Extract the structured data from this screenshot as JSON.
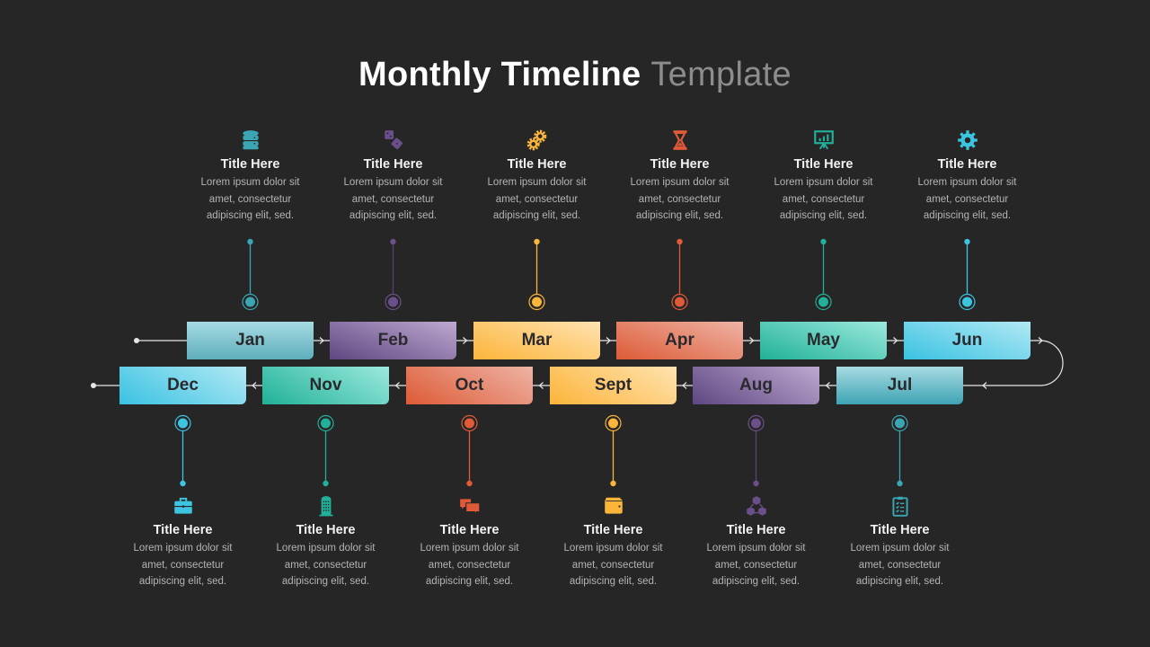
{
  "header": {
    "title_bold": "Monthly Timeline",
    "title_light": "Template"
  },
  "months": [
    {
      "label": "Jan",
      "color": "#3aa6b4",
      "grad": [
        "#5eaebb",
        "#a6dbe3"
      ],
      "icon": "database-icon"
    },
    {
      "label": "Feb",
      "color": "#6b4f8a",
      "grad": [
        "#5e4781",
        "#bda9d1"
      ],
      "icon": "dice-icon"
    },
    {
      "label": "Mar",
      "color": "#fbb53a",
      "grad": [
        "#fcb43a",
        "#ffe3b0"
      ],
      "icon": "gears-icon"
    },
    {
      "label": "Apr",
      "color": "#e15a38",
      "grad": [
        "#dd5b36",
        "#eeb3a5"
      ],
      "icon": "hourglass-icon"
    },
    {
      "label": "May",
      "color": "#22b09a",
      "grad": [
        "#20b197",
        "#9ce9de"
      ],
      "icon": "presentation-chart-icon"
    },
    {
      "label": "Jun",
      "color": "#3cc4e0",
      "grad": [
        "#3ac2e2",
        "#b2e9f4"
      ],
      "icon": "settings-gear-icon"
    },
    {
      "label": "Jul",
      "color": "#3aa6b4",
      "grad": [
        "#3ea4b4",
        "#a8dbe2"
      ],
      "icon": "clipboard-checklist-icon"
    },
    {
      "label": "Aug",
      "color": "#6b4f8a",
      "grad": [
        "#5e4781",
        "#bda9d1"
      ],
      "icon": "network-cubes-icon"
    },
    {
      "label": "Sept",
      "color": "#fbb53a",
      "grad": [
        "#fcb43a",
        "#ffe3b0"
      ],
      "icon": "wallet-icon"
    },
    {
      "label": "Oct",
      "color": "#e15a38",
      "grad": [
        "#dd5b36",
        "#eeb3a5"
      ],
      "icon": "chat-bubbles-icon"
    },
    {
      "label": "Nov",
      "color": "#22b09a",
      "grad": [
        "#20b197",
        "#9ce9de"
      ],
      "icon": "office-building-icon"
    },
    {
      "label": "Dec",
      "color": "#3cc4e0",
      "grad": [
        "#3ac2e2",
        "#b2e9f4"
      ],
      "icon": "briefcase-icon"
    }
  ],
  "cards": [
    {
      "month": "Jan",
      "title": "Title Here",
      "lines": [
        "Lorem ipsum dolor sit",
        "amet, consectetur",
        "adipiscing elit, sed."
      ]
    },
    {
      "month": "Feb",
      "title": "Title Here",
      "lines": [
        "Lorem ipsum dolor sit",
        "amet, consectetur",
        "adipiscing elit, sed."
      ]
    },
    {
      "month": "Mar",
      "title": "Title Here",
      "lines": [
        "Lorem ipsum dolor sit",
        "amet, consectetur",
        "adipiscing elit, sed."
      ]
    },
    {
      "month": "Apr",
      "title": "Title Here",
      "lines": [
        "Lorem ipsum dolor sit",
        "amet, consectetur",
        "adipiscing elit, sed."
      ]
    },
    {
      "month": "May",
      "title": "Title Here",
      "lines": [
        "Lorem ipsum dolor sit",
        "amet, consectetur",
        "adipiscing elit, sed."
      ]
    },
    {
      "month": "Jun",
      "title": "Title Here",
      "lines": [
        "Lorem ipsum dolor sit",
        "amet, consectetur",
        "adipiscing elit, sed."
      ]
    },
    {
      "month": "Jul",
      "title": "Title Here",
      "lines": [
        "Lorem ipsum dolor sit",
        "amet, consectetur",
        "adipiscing elit, sed."
      ]
    },
    {
      "month": "Aug",
      "title": "Title Here",
      "lines": [
        "Lorem ipsum dolor sit",
        "amet, consectetur",
        "adipiscing elit, sed."
      ]
    },
    {
      "month": "Sept",
      "title": "Title Here",
      "lines": [
        "Lorem ipsum dolor sit",
        "amet, consectetur",
        "adipiscing elit, sed."
      ]
    },
    {
      "month": "Oct",
      "title": "Title Here",
      "lines": [
        "Lorem ipsum dolor sit",
        "amet, consectetur",
        "adipiscing elit, sed."
      ]
    },
    {
      "month": "Nov",
      "title": "Title Here",
      "lines": [
        "Lorem ipsum dolor sit",
        "amet, consectetur",
        "adipiscing elit, sed."
      ]
    },
    {
      "month": "Dec",
      "title": "Title Here",
      "lines": [
        "Lorem ipsum dolor sit",
        "amet, consectetur",
        "adipiscing elit, sed."
      ]
    }
  ],
  "connector_color": "#e6e6e6"
}
